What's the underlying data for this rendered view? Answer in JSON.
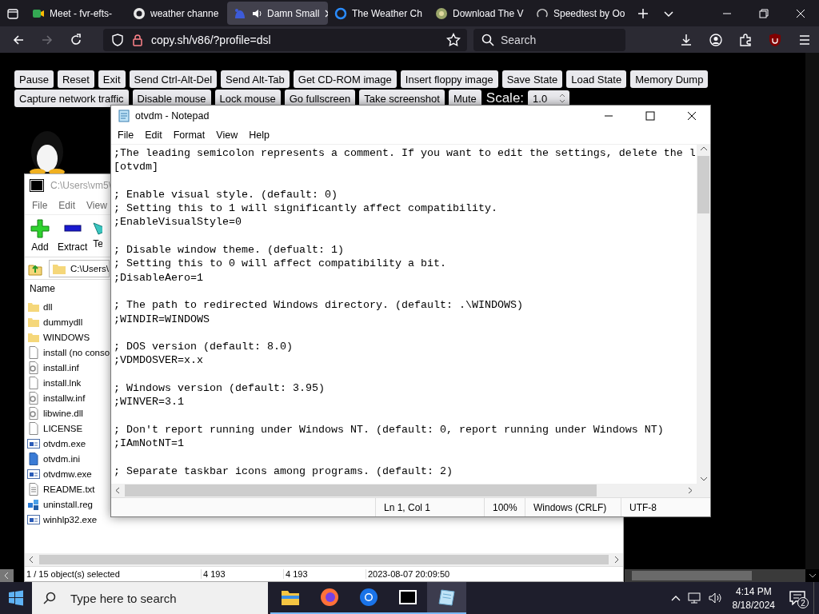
{
  "browser": {
    "tabs": [
      {
        "title": "Meet - fvr-efts-",
        "kind": "meet",
        "selected": false,
        "audio": false
      },
      {
        "title": "weather channe",
        "kind": "google",
        "selected": false,
        "audio": false
      },
      {
        "title": "Damn Small",
        "kind": "dsl",
        "selected": true,
        "audio": true
      },
      {
        "title": "The Weather Ch",
        "kind": "search",
        "selected": false,
        "audio": false
      },
      {
        "title": "Download The V",
        "kind": "download",
        "selected": false,
        "audio": false
      },
      {
        "title": "Speedtest by Oo",
        "kind": "speedtest",
        "selected": false,
        "audio": false
      }
    ],
    "nav_buttons": [
      {
        "kind": "back",
        "disabled": false
      },
      {
        "kind": "forward",
        "disabled": true
      },
      {
        "kind": "reload",
        "disabled": false
      }
    ],
    "address": "copy.sh/v86/?profile=dsl",
    "search": {
      "placeholder": "Search"
    }
  },
  "emulator": {
    "buttons": [
      [
        "Pause",
        "Reset",
        "Exit",
        "Send Ctrl-Alt-Del",
        "Send Alt-Tab",
        "Get CD-ROM image",
        "Insert floppy image",
        "Save State",
        "Load State",
        "Memory Dump"
      ],
      [
        "Capture network traffic",
        "Disable mouse",
        "Lock mouse",
        "Go fullscreen",
        "Take screenshot",
        "Mute"
      ]
    ],
    "scale": {
      "label": "Scale:",
      "value": "1.0"
    }
  },
  "archive_window": {
    "title": "C:\\Users\\vm5\\",
    "menu": [
      "File",
      "Edit",
      "View"
    ],
    "toolbar": [
      {
        "label": "Add",
        "kind": "add"
      },
      {
        "label": "Extract",
        "kind": "extract"
      },
      {
        "label": "Te",
        "kind": "test"
      }
    ],
    "path": "C:\\Users\\",
    "columns": [
      "Name"
    ],
    "files": [
      {
        "name": "dll",
        "kind": "folder"
      },
      {
        "name": "dummydll",
        "kind": "folder"
      },
      {
        "name": "WINDOWS",
        "kind": "folder"
      },
      {
        "name": "install (no conso",
        "kind": "blank"
      },
      {
        "name": "install.inf",
        "kind": "gear"
      },
      {
        "name": "install.lnk",
        "kind": "blank"
      },
      {
        "name": "installw.inf",
        "kind": "gear"
      },
      {
        "name": "libwine.dll",
        "kind": "gear"
      },
      {
        "name": "LICENSE",
        "kind": "blank"
      },
      {
        "name": "otvdm.exe",
        "kind": "app"
      },
      {
        "name": "otvdm.ini",
        "kind": "ini"
      },
      {
        "name": "otvdmw.exe",
        "kind": "app"
      },
      {
        "name": "README.txt",
        "kind": "text"
      },
      {
        "name": "uninstall.reg",
        "kind": "reg"
      },
      {
        "name": "winhlp32.exe",
        "kind": "app"
      }
    ],
    "status": [
      "1 / 15 object(s) selected",
      "4 193",
      "4 193",
      "2023-08-07 20:09:50"
    ]
  },
  "notepad": {
    "title": "otvdm - Notepad",
    "menu": [
      "File",
      "Edit",
      "Format",
      "View",
      "Help"
    ],
    "paragraphs": [
      [
        ";The leading semicolon represents a comment. If you want to edit the settings, delete the l",
        "[otvdm]"
      ],
      [
        "; Enable visual style. (default: 0)",
        "; Setting this to 1 will significantly affect compatibility.",
        ";EnableVisualStyle=0"
      ],
      [
        "; Disable window theme. (defualt: 1)",
        "; Setting this to 0 will affect compatibility a bit.",
        ";DisableAero=1"
      ],
      [
        "; The path to redirected Windows directory. (default: .\\WINDOWS)",
        ";WINDIR=WINDOWS"
      ],
      [
        "; DOS version (default: 8.0)",
        ";VDMDOSVER=x.x"
      ],
      [
        "; Windows version (default: 3.95)",
        ";WINVER=3.1"
      ],
      [
        "; Don't report running under Windows NT. (default: 0, report running under Windows NT)",
        ";IAmNotNT=1"
      ],
      [
        "; Separate taskbar icons among programs. (default: 2)"
      ]
    ],
    "status": [
      "Ln 1, Col 1",
      "100%",
      "Windows (CRLF)",
      "UTF-8"
    ]
  },
  "taskbar": {
    "search": {
      "placeholder": "Type here to search"
    },
    "apps": [
      {
        "kind": "files",
        "selected": false
      },
      {
        "kind": "firefox",
        "selected": false
      },
      {
        "kind": "chrome",
        "selected": false
      },
      {
        "kind": "archiver",
        "selected": false
      },
      {
        "kind": "notepad",
        "selected": true
      }
    ],
    "time": "4:14 PM",
    "date": "8/18/2024",
    "notifications": "2"
  }
}
